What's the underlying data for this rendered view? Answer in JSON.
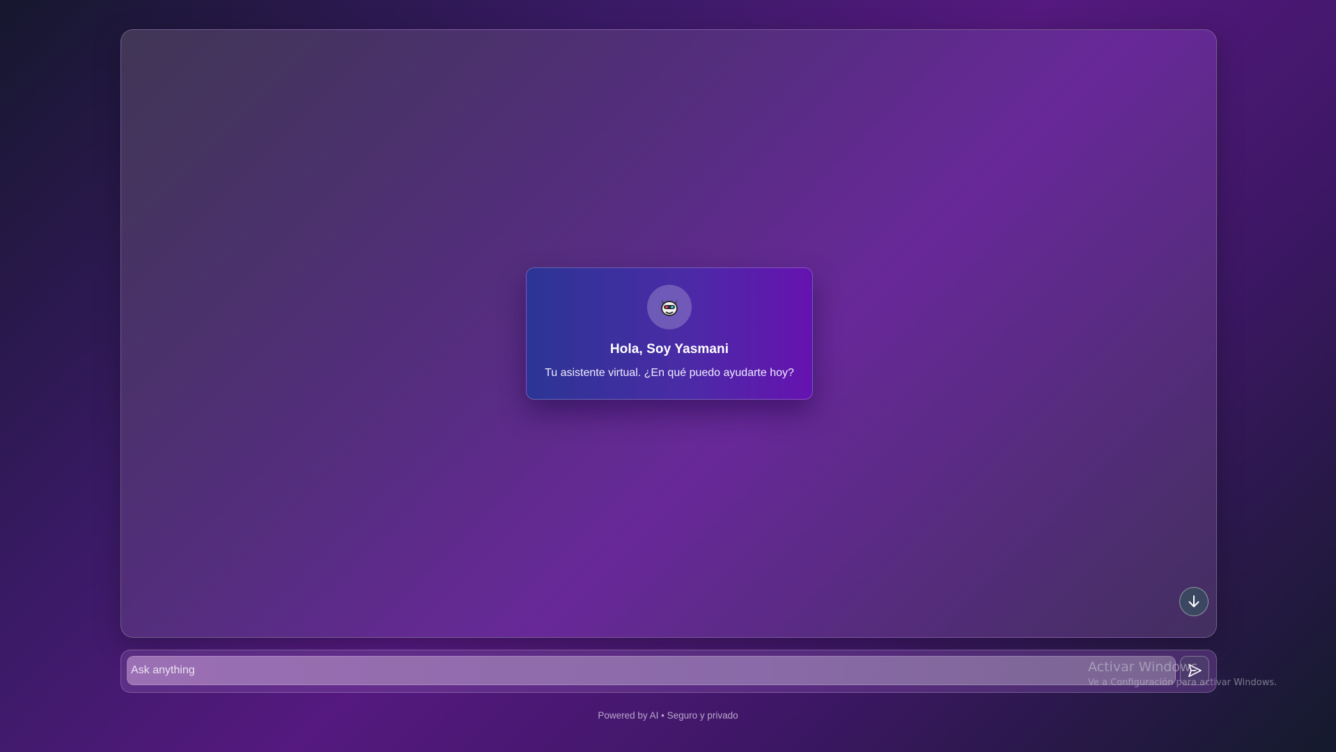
{
  "welcome": {
    "avatar_icon": "robot-avatar-icon",
    "title": "Hola, Soy Yasmani",
    "subtitle": "Tu asistente virtual. ¿En qué puedo ayudarte hoy?"
  },
  "chat": {
    "scroll_down_icon": "arrow-down-icon"
  },
  "composer": {
    "placeholder": "Ask anything",
    "value": "",
    "send_icon": "send-icon"
  },
  "footer": {
    "note": "Powered by AI • Seguro y privado"
  },
  "watermark": {
    "title": "Activar Windows",
    "subtitle": "Ve a Configuración para activar Windows."
  },
  "colors": {
    "accent_purple": "#6612b0",
    "accent_indigo": "#2b3594",
    "background_dark": "#16172e"
  }
}
